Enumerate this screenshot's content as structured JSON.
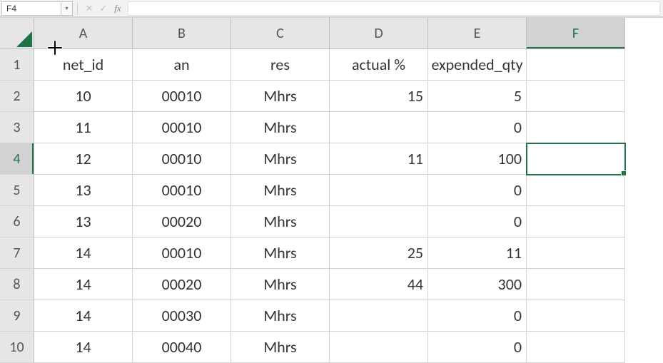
{
  "formula_bar": {
    "name_box": "F4",
    "cancel": "✕",
    "accept": "✓",
    "fx": "fx",
    "formula_value": ""
  },
  "columns": [
    "A",
    "B",
    "C",
    "D",
    "E",
    "F"
  ],
  "active_column_index": 5,
  "active_row_index": 3,
  "headers": [
    "net_id",
    "an",
    "res",
    "actual %",
    "expended_qty",
    ""
  ],
  "rows": [
    {
      "n": "1"
    },
    {
      "n": "2",
      "A": "10",
      "B": "00010",
      "C": "Mhrs",
      "D": "15",
      "E": "5"
    },
    {
      "n": "3",
      "A": "11",
      "B": "00010",
      "C": "Mhrs",
      "D": "",
      "E": "0"
    },
    {
      "n": "4",
      "A": "12",
      "B": "00010",
      "C": "Mhrs",
      "D": "11",
      "E": "100"
    },
    {
      "n": "5",
      "A": "13",
      "B": "00010",
      "C": "Mhrs",
      "D": "",
      "E": "0"
    },
    {
      "n": "6",
      "A": "13",
      "B": "00020",
      "C": "Mhrs",
      "D": "",
      "E": "0"
    },
    {
      "n": "7",
      "A": "14",
      "B": "00010",
      "C": "Mhrs",
      "D": "25",
      "E": "11"
    },
    {
      "n": "8",
      "A": "14",
      "B": "00020",
      "C": "Mhrs",
      "D": "44",
      "E": "300"
    },
    {
      "n": "9",
      "A": "14",
      "B": "00030",
      "C": "Mhrs",
      "D": "",
      "E": "0"
    },
    {
      "n": "10",
      "A": "14",
      "B": "00040",
      "C": "Mhrs",
      "D": "",
      "E": "0"
    }
  ],
  "selected_cell": "F4"
}
